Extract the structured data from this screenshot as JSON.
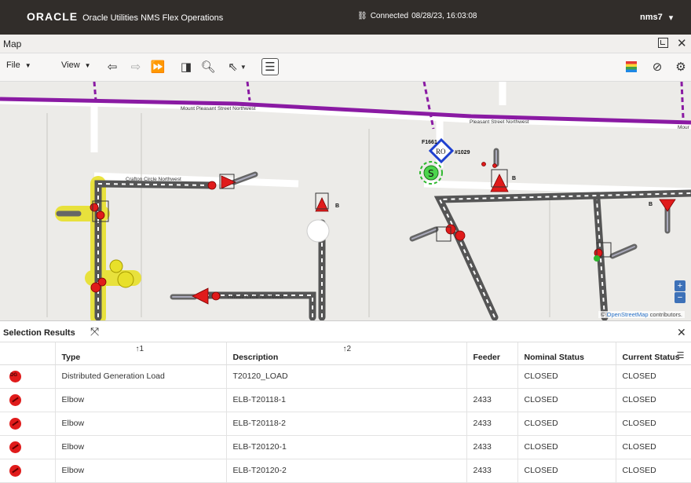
{
  "header": {
    "brand": "ORACLE",
    "app_title": "Oracle Utilities NMS Flex Operations",
    "connection": "Connected",
    "timestamp": "08/28/23, 16:03:08",
    "user": "nms7"
  },
  "map_panel": {
    "title": "Map",
    "toolbar": {
      "file_label": "File",
      "view_label": "View"
    },
    "street_labels": {
      "mount_pleasant": "Mount Pleasant Street Northwest",
      "pleasant_street": "Pleasant Street Northwest",
      "crafton": "Crafton Circle Northwest",
      "mount_short": "Mour",
      "lower_road": "Hillside Circle Northwest"
    },
    "device_labels": {
      "f1661": "F1661",
      "ro": "RO",
      "device_1029": "#1029",
      "b": "B"
    },
    "attribution_prefix": "©",
    "attribution_link": "OpenStreetMap",
    "attribution_suffix": "contributors."
  },
  "selection": {
    "title": "Selection Results",
    "columns": [
      {
        "label": "",
        "sort": ""
      },
      {
        "label": "Type",
        "sort": "↑1"
      },
      {
        "label": "Description",
        "sort": "↑2"
      },
      {
        "label": "Feeder",
        "sort": ""
      },
      {
        "label": "Nominal Status",
        "sort": ""
      },
      {
        "label": "Current Status",
        "sort": ""
      }
    ],
    "rows": [
      {
        "icon": "distributed-generation-load-icon",
        "type": "Distributed Generation Load",
        "description": "T20120_LOAD",
        "feeder": "",
        "nominal": "CLOSED",
        "current": "CLOSED"
      },
      {
        "icon": "elbow-icon",
        "type": "Elbow",
        "description": "ELB-T20118-1",
        "feeder": "2433",
        "nominal": "CLOSED",
        "current": "CLOSED"
      },
      {
        "icon": "elbow-icon",
        "type": "Elbow",
        "description": "ELB-T20118-2",
        "feeder": "2433",
        "nominal": "CLOSED",
        "current": "CLOSED"
      },
      {
        "icon": "elbow-icon",
        "type": "Elbow",
        "description": "ELB-T20120-1",
        "feeder": "2433",
        "nominal": "CLOSED",
        "current": "CLOSED"
      },
      {
        "icon": "elbow-icon",
        "type": "Elbow",
        "description": "ELB-T20120-2",
        "feeder": "2433",
        "nominal": "CLOSED",
        "current": "CLOSED"
      }
    ]
  },
  "colors": {
    "header_bg": "#312d2a",
    "feeder_line": "#8a1aa3",
    "device_red": "#e01b1b",
    "highlight_yellow": "#e8e02a",
    "zoom_blue": "#3d71b8"
  }
}
